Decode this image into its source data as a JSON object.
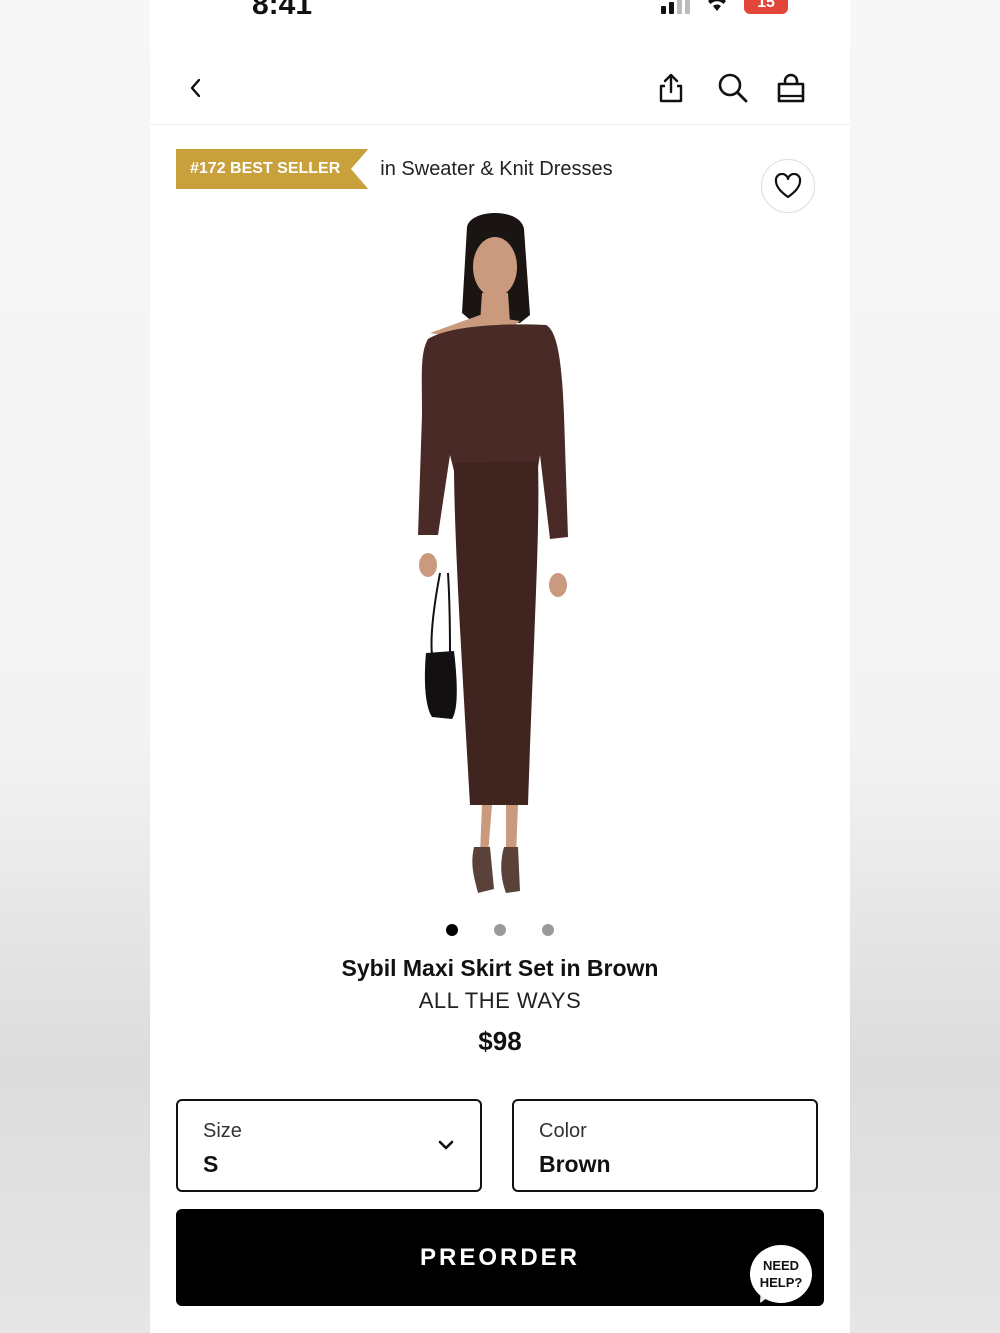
{
  "status_bar": {
    "time": "8:41",
    "battery": "15"
  },
  "header": {
    "back_icon": "chevron-left-icon",
    "share_icon": "share-icon",
    "search_icon": "search-icon",
    "bag_icon": "shopping-bag-icon"
  },
  "badge": {
    "rank_label": "#172 BEST SELLER",
    "category": "in Sweater & Knit Dresses",
    "color": "#c9a13c"
  },
  "wishlist_icon": "heart-icon",
  "gallery": {
    "image_count": 3,
    "active_index": 0
  },
  "product": {
    "title": "Sybil Maxi Skirt Set in Brown",
    "brand": "ALL THE WAYS",
    "price": "$98",
    "garment_color": "#4a2a26"
  },
  "size_select": {
    "label": "Size",
    "value": "S"
  },
  "color_select": {
    "label": "Color",
    "value": "Brown"
  },
  "cta": {
    "label": "PREORDER"
  },
  "help": {
    "line1": "NEED",
    "line2": "HELP?"
  }
}
